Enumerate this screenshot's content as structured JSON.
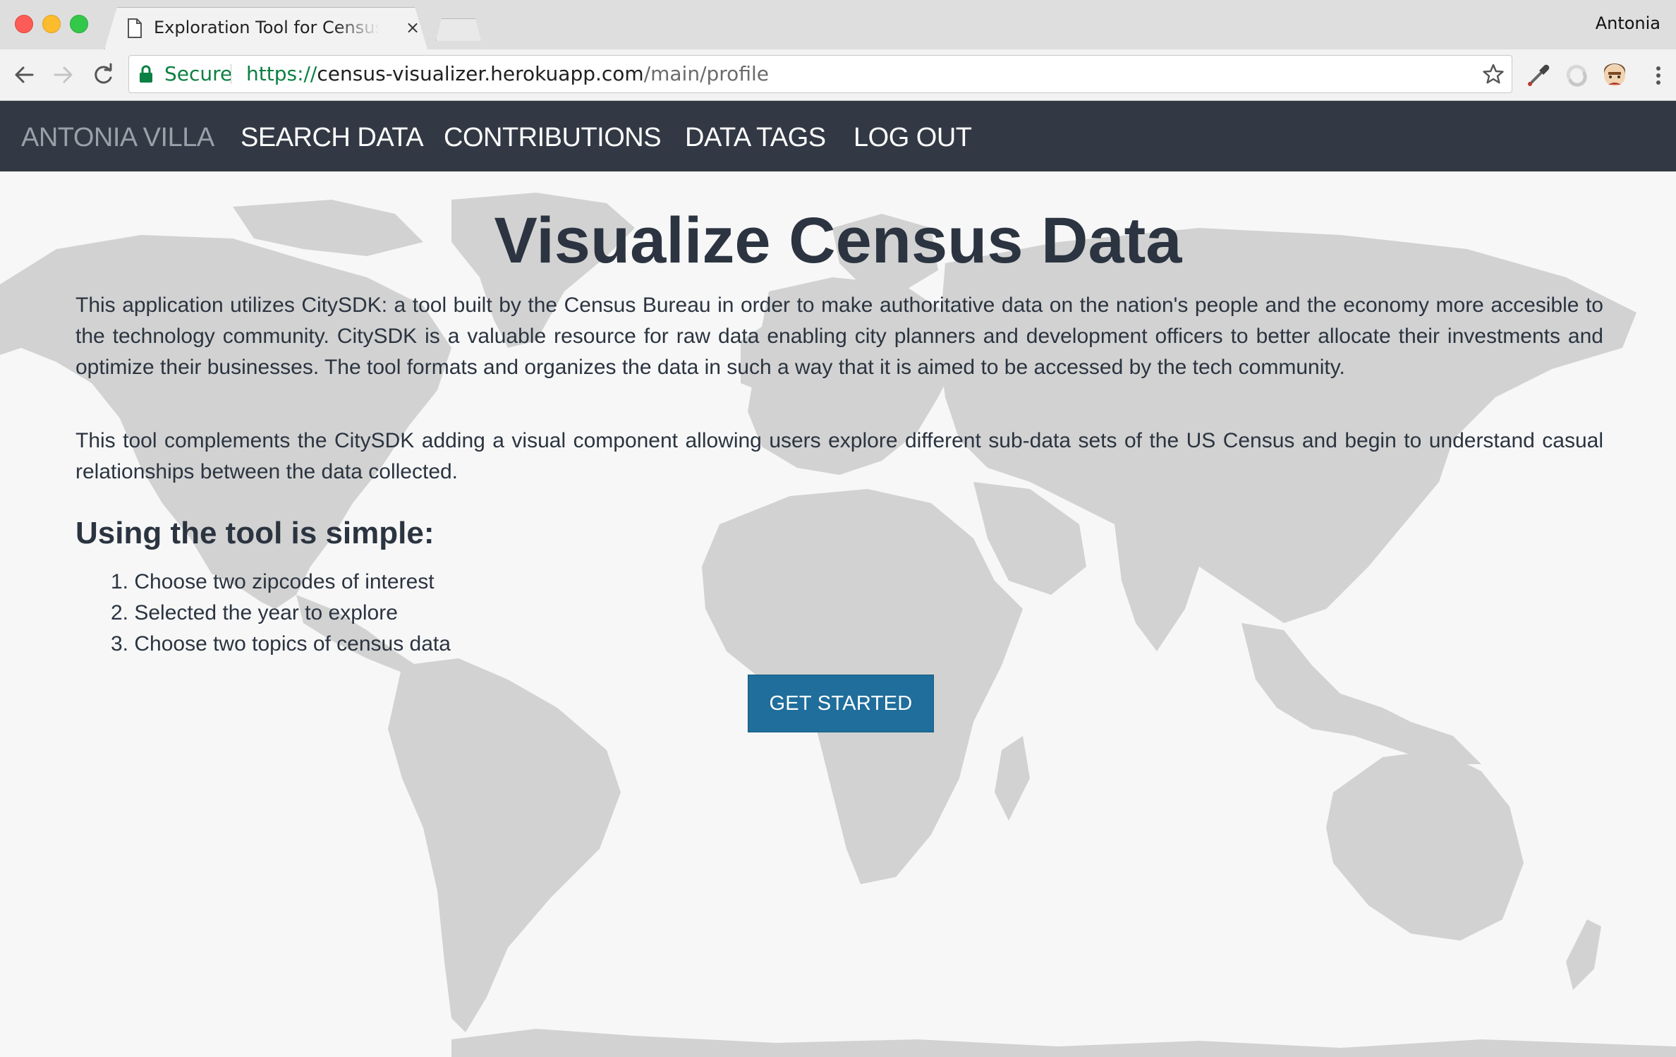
{
  "browser": {
    "tab_title": "Exploration Tool for Census Da",
    "tab_close": "×",
    "profile_name": "Antonia",
    "secure_label": "Secure",
    "url": {
      "scheme": "https://",
      "host": "census-visualizer.herokuapp.com",
      "path": "/main/profile"
    },
    "icons": {
      "back": "arrow-left-icon",
      "forward": "arrow-right-icon",
      "reload": "reload-icon",
      "lock": "lock-icon",
      "bookmark": "star-icon",
      "eyedropper": "eyedropper-icon",
      "extension": "extension-swirl-icon",
      "profile": "profile-avatar-icon",
      "menu": "kebab-menu-icon"
    }
  },
  "navbar": {
    "brand": "ANTONIA VILLA",
    "items": [
      "SEARCH DATA",
      "CONTRIBUTIONS",
      "DATA TAGS",
      "LOG OUT"
    ]
  },
  "main": {
    "title": "Visualize Census Data",
    "paragraphs": [
      "This application utilizes CitySDK: a tool built by the Census Bureau in order to make authoritative data on the nation's people and the economy more accesible to the technology community. CitySDK is a valuable resource for raw data enabling city planners and development officers to better allocate their investments and optimize their businesses. The tool formats and organizes the data in such a way that it is aimed to be accessed by the tech community.",
      "This tool complements the CitySDK adding a visual component allowing users explore different sub-data sets of the US Census and begin to understand casual relationships between the data collected."
    ],
    "subheading": "Using the tool is simple:",
    "steps": [
      "1. Choose two zipcodes of interest",
      "2. Selected the year to explore",
      "3. Choose two topics of census data"
    ],
    "cta_label": "GET STARTED"
  },
  "colors": {
    "navbar_bg": "#323944",
    "text": "#2b3440",
    "cta_bg": "#1f6e9c",
    "map_land": "#d2d2d2",
    "secure_green": "#0b8043"
  }
}
